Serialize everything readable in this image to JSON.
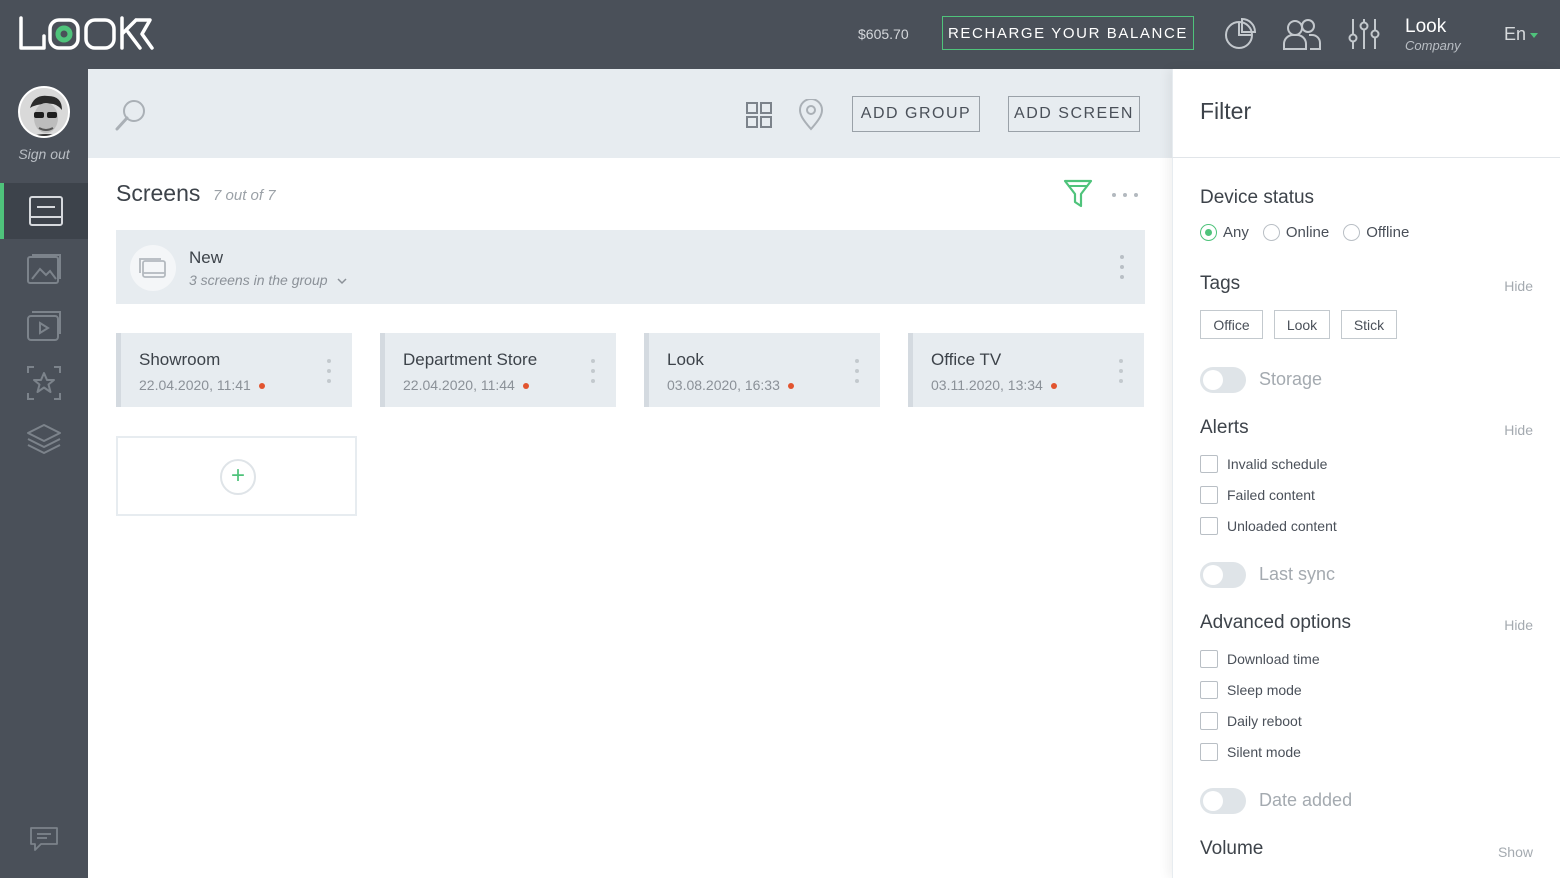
{
  "header": {
    "logo_text": "LOOK",
    "balance": "$605.70",
    "recharge_label": "RECHARGE YOUR BALANCE",
    "icons": [
      "analytics-icon",
      "users-icon",
      "settings-sliders-icon"
    ],
    "company_name": "Look",
    "company_sub": "Company",
    "language": "En"
  },
  "sidebar": {
    "signout_label": "Sign out",
    "items": [
      {
        "icon": "screens-icon",
        "active": true
      },
      {
        "icon": "images-icon",
        "active": false
      },
      {
        "icon": "video-icon",
        "active": false
      },
      {
        "icon": "star-icon",
        "active": false
      },
      {
        "icon": "layers-icon",
        "active": false
      }
    ],
    "chat_icon": "chat-icon"
  },
  "toolbar": {
    "add_group_label": "ADD GROUP",
    "add_screen_label": "ADD SCREEN"
  },
  "main": {
    "title": "Screens",
    "count": "7 out of 7",
    "group": {
      "name": "New",
      "subtitle": "3 screens in the group"
    },
    "screens": [
      {
        "name": "Showroom",
        "date": "22.04.2020, 11:41"
      },
      {
        "name": "Department Store",
        "date": "22.04.2020, 11:44"
      },
      {
        "name": "Look",
        "date": "03.08.2020, 16:33"
      },
      {
        "name": "Office TV",
        "date": "03.11.2020, 13:34"
      }
    ]
  },
  "filter": {
    "title": "Filter",
    "device_status": {
      "title": "Device status",
      "options": [
        "Any",
        "Online",
        "Offline"
      ],
      "selected": "Any"
    },
    "tags": {
      "title": "Tags",
      "toggle_link": "Hide",
      "items": [
        "Office",
        "Look",
        "Stick"
      ]
    },
    "storage_label": "Storage",
    "alerts": {
      "title": "Alerts",
      "toggle_link": "Hide",
      "items": [
        "Invalid schedule",
        "Failed content",
        "Unloaded content"
      ]
    },
    "last_sync_label": "Last sync",
    "advanced": {
      "title": "Advanced options",
      "toggle_link": "Hide",
      "items": [
        "Download time",
        "Sleep mode",
        "Daily reboot",
        "Silent mode"
      ]
    },
    "date_added_label": "Date added",
    "volume": {
      "title": "Volume",
      "toggle_link": "Show"
    }
  },
  "colors": {
    "accent": "#4fc37b",
    "dark_bar": "#4a5059",
    "panel_bg": "#e7ecf0",
    "status_red": "#e2542f"
  }
}
